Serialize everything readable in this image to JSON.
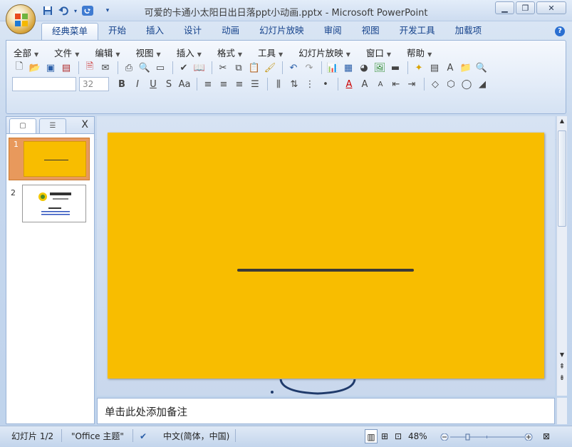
{
  "window": {
    "title": "可爱的卡通小太阳日出日落ppt小动画.pptx - Microsoft PowerPoint",
    "minimize_icon": "minimize-icon",
    "maximize_icon": "restore-icon",
    "close_icon": "close-icon"
  },
  "quick_access": [
    "save-icon",
    "undo-icon",
    "dropdown-icon",
    "redo-icon",
    "customize-icon"
  ],
  "ribbon_tabs": [
    "经典菜单",
    "开始",
    "插入",
    "设计",
    "动画",
    "幻灯片放映",
    "审阅",
    "视图",
    "开发工具",
    "加载项"
  ],
  "active_tab": "经典菜单",
  "classic_menus": [
    "全部",
    "文件",
    "编辑",
    "视图",
    "插入",
    "格式",
    "工具",
    "幻灯片放映",
    "窗口",
    "帮助"
  ],
  "font_size_value": "32",
  "font_name_value": "",
  "colors": {
    "slide_bg": "#f8bd00",
    "accent": "#15428b",
    "thumb_selected": "#e8995c"
  },
  "left_panel": {
    "tabs": [
      "slides-tab-icon",
      "outline-tab-icon"
    ],
    "close_label": "X"
  },
  "slides": [
    {
      "number": "1"
    },
    {
      "number": "2"
    }
  ],
  "thumb2": {
    "brand_line1": "柠檬小居",
    "brand_line2": "Lemon Store"
  },
  "notes_placeholder": "单击此处添加备注",
  "status": {
    "slide": "幻灯片 1/2",
    "theme": "\"Office 主题\"",
    "language": "中文(简体，中国)",
    "zoom": "48%"
  }
}
